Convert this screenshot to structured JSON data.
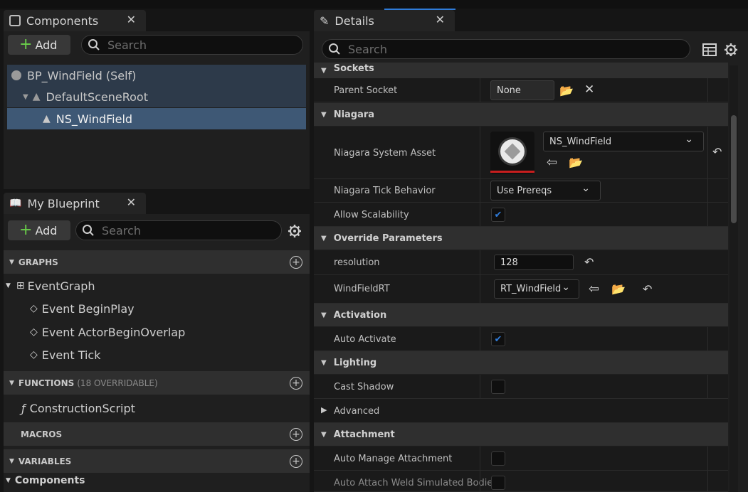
{
  "components_panel": {
    "tab_title": "Components",
    "add_label": "Add",
    "search_placeholder": "Search",
    "tree": [
      {
        "label": "BP_WindField (Self)"
      },
      {
        "label": "DefaultSceneRoot"
      },
      {
        "label": "NS_WindField"
      }
    ]
  },
  "blueprint_panel": {
    "tab_title": "My Blueprint",
    "add_label": "Add",
    "search_placeholder": "Search",
    "sections": {
      "graphs": "GRAPHS",
      "functions": "FUNCTIONS",
      "functions_note": "(18 OVERRIDABLE)",
      "macros": "MACROS",
      "variables": "VARIABLES",
      "components": "Components"
    },
    "event_graph": "EventGraph",
    "events": [
      "Event BeginPlay",
      "Event ActorBeginOverlap",
      "Event Tick"
    ],
    "function_item": "ConstructionScript"
  },
  "details_panel": {
    "tab_title": "Details",
    "search_placeholder": "Search",
    "categories": {
      "sockets": "Sockets",
      "niagara": "Niagara",
      "override": "Override Parameters",
      "activation": "Activation",
      "lighting": "Lighting",
      "attachment": "Attachment"
    },
    "rows": {
      "parent_socket": {
        "label": "Parent Socket",
        "value": "None"
      },
      "system_asset": {
        "label": "Niagara System Asset",
        "value": "NS_WindField"
      },
      "tick_behavior": {
        "label": "Niagara Tick Behavior",
        "value": "Use Prereqs"
      },
      "allow_scalability": {
        "label": "Allow Scalability",
        "checked": true
      },
      "resolution": {
        "label": "resolution",
        "value": "128"
      },
      "windfield_rt": {
        "label": "WindFieldRT",
        "value": "RT_WindField"
      },
      "auto_activate": {
        "label": "Auto Activate",
        "checked": true
      },
      "cast_shadow": {
        "label": "Cast Shadow",
        "checked": false
      },
      "advanced": {
        "label": "Advanced"
      },
      "auto_manage": {
        "label": "Auto Manage Attachment",
        "checked": false
      },
      "auto_attach_weld": {
        "label": "Auto Attach Weld Simulated Bodies"
      }
    }
  },
  "colors": {
    "selection": "#3e5875",
    "accent_blue": "#2f7bd8",
    "add_green": "#6ad04a",
    "asset_underline": "#c81e1e"
  }
}
